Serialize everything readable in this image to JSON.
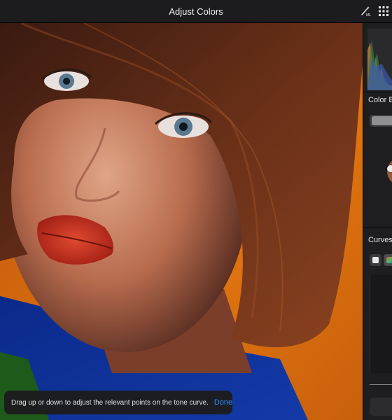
{
  "header": {
    "title": "Adjust Colors",
    "ml_icon": "magic-wand-ml-icon",
    "grid_icon": "grid-icon"
  },
  "photo": {
    "description_icon": "photo-canvas"
  },
  "sidebar": {
    "color_balance_title": "Color B",
    "curves_title": "Curves"
  },
  "toast": {
    "message": "Drag up or down to adjust the relevant points on the tone curve.",
    "done_label": "Done"
  },
  "colors": {
    "accent": "#2f8cff",
    "topbar": "#1c1c1e",
    "sidebar": "#1e1e20",
    "background_orange": "#d0620c"
  }
}
